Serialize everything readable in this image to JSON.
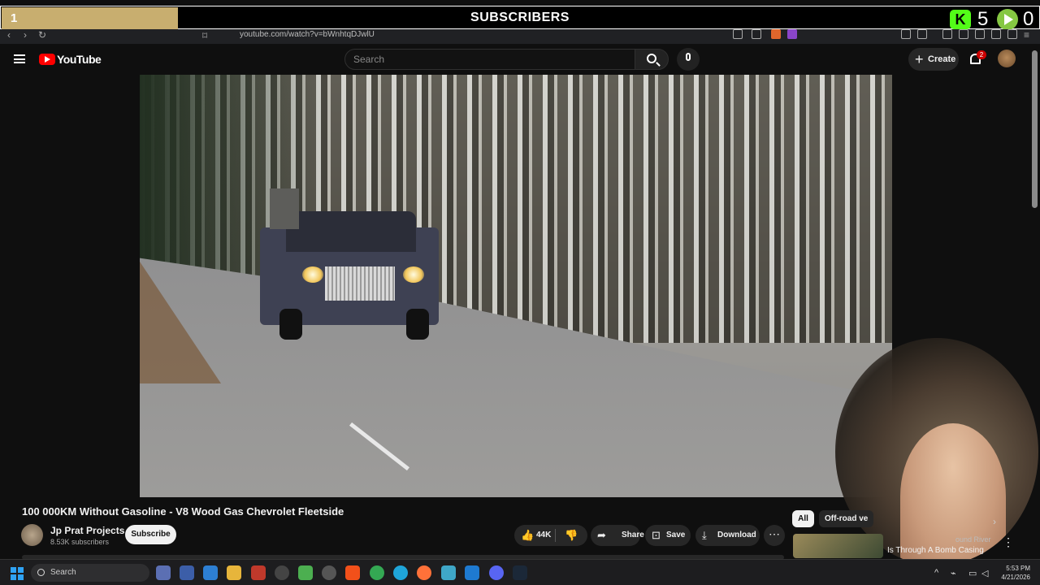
{
  "overlay": {
    "count": "1",
    "title": "SUBSCRIBERS",
    "progress_fraction": 0.17,
    "kick_count": "5",
    "rumble_count": "0",
    "accent_gold": "#c8ae6f"
  },
  "browser": {
    "url": "youtube.com/watch?v=bWnhtqDJwlU"
  },
  "header": {
    "logo_text": "YouTube",
    "search_placeholder": "Search",
    "create_label": "Create",
    "notification_count": "2"
  },
  "video": {
    "title": "100 000KM Without Gasoline - V8 Wood Gas Chevrolet Fleetside",
    "channel_name": "Jp Prat Projects",
    "channel_subs": "8.53K subscribers",
    "subscribe_label": "Subscribe",
    "likes": "44K",
    "share_label": "Share",
    "save_label": "Save",
    "download_label": "Download"
  },
  "sidebar": {
    "chips": [
      "All",
      "Off-road ve"
    ],
    "rec_title_1": "ound River",
    "rec_title_2": "Is Through A Bomb Casing"
  },
  "taskbar": {
    "search_label": "Search",
    "time": "5:53 PM",
    "date": "4/21/2026"
  },
  "icons": [
    "menu-icon",
    "youtube-logo-icon",
    "search-icon",
    "mic-icon",
    "plus-icon",
    "bell-icon",
    "like-icon",
    "dislike-icon",
    "share-icon",
    "save-icon",
    "download-icon",
    "more-icon",
    "windows-icon"
  ]
}
